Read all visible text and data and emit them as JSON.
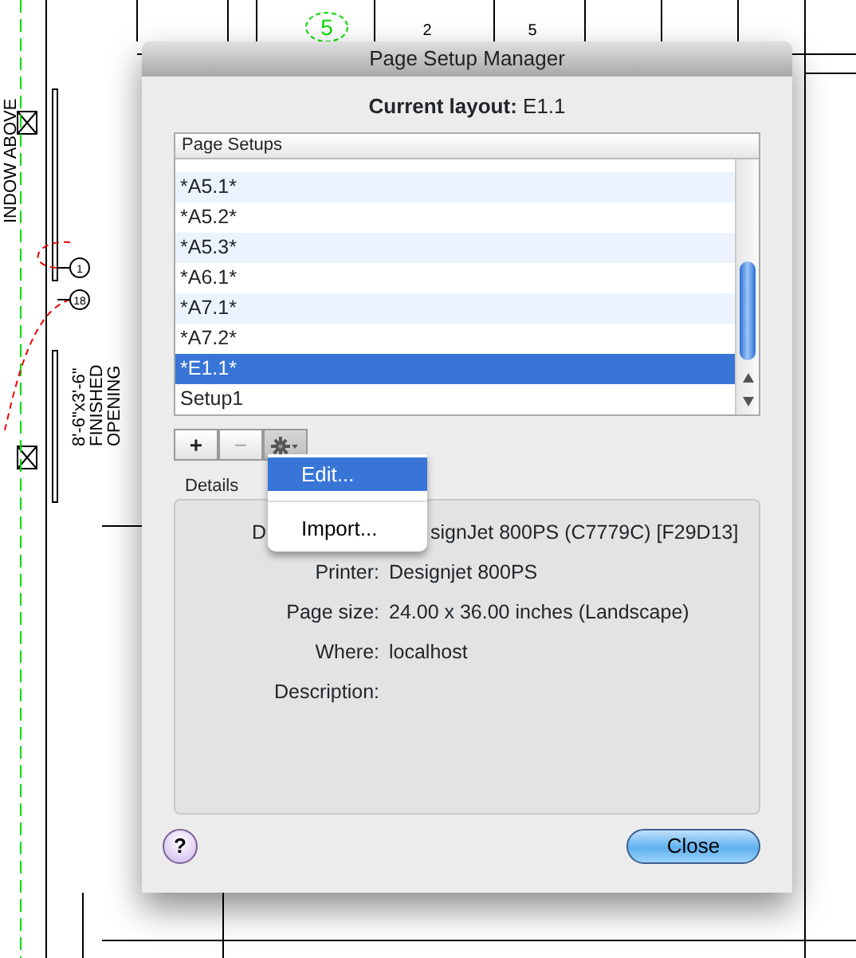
{
  "drawing": {
    "labels": [
      {
        "kind": "marker",
        "text": "5"
      },
      {
        "kind": "grid",
        "text": "2"
      },
      {
        "kind": "grid",
        "text": "5"
      },
      {
        "kind": "tag",
        "text": "1"
      },
      {
        "kind": "tag",
        "text": "18"
      },
      {
        "kind": "note",
        "text": "INDOW ABOVE"
      },
      {
        "kind": "note",
        "text": "8'-6\"x3'-6\""
      },
      {
        "kind": "note",
        "text": "FINISHED"
      },
      {
        "kind": "note",
        "text": "OPENING"
      }
    ]
  },
  "window": {
    "title": "Page Setup Manager"
  },
  "current_layout": {
    "label": "Current layout:",
    "value": "E1.1"
  },
  "list": {
    "header": "Page Setups",
    "items": [
      {
        "name": "*A5.1*",
        "selected": false
      },
      {
        "name": "*A5.2*",
        "selected": false
      },
      {
        "name": "*A5.3*",
        "selected": false
      },
      {
        "name": "*A6.1*",
        "selected": false
      },
      {
        "name": "*A7.1*",
        "selected": false
      },
      {
        "name": "*A7.2*",
        "selected": false
      },
      {
        "name": "*E1.1*",
        "selected": true
      },
      {
        "name": "Setup1",
        "selected": false
      }
    ]
  },
  "buttons": [
    {
      "kind": "add",
      "label": "+",
      "disabled": false
    },
    {
      "kind": "remove",
      "label": "−",
      "disabled": true
    },
    {
      "kind": "action"
    }
  ],
  "menu": {
    "items": [
      {
        "label": "Edit...",
        "selected": true
      },
      {
        "label": "Import...",
        "selected": false
      }
    ]
  },
  "details": {
    "title": "Details",
    "rows": [
      {
        "kind": "covered",
        "label": "D",
        "value": "signJet 800PS (C7779C) [F29D13]"
      },
      {
        "kind": "field",
        "label": "Printer:",
        "value": "Designjet 800PS"
      },
      {
        "kind": "field",
        "label": "Page size:",
        "value": "24.00 x 36.00 inches (Landscape)"
      },
      {
        "kind": "field",
        "label": "Where:",
        "value": "localhost"
      },
      {
        "kind": "field",
        "label": "Description:"
      }
    ]
  },
  "footer": {
    "help": "?",
    "close": "Close"
  }
}
